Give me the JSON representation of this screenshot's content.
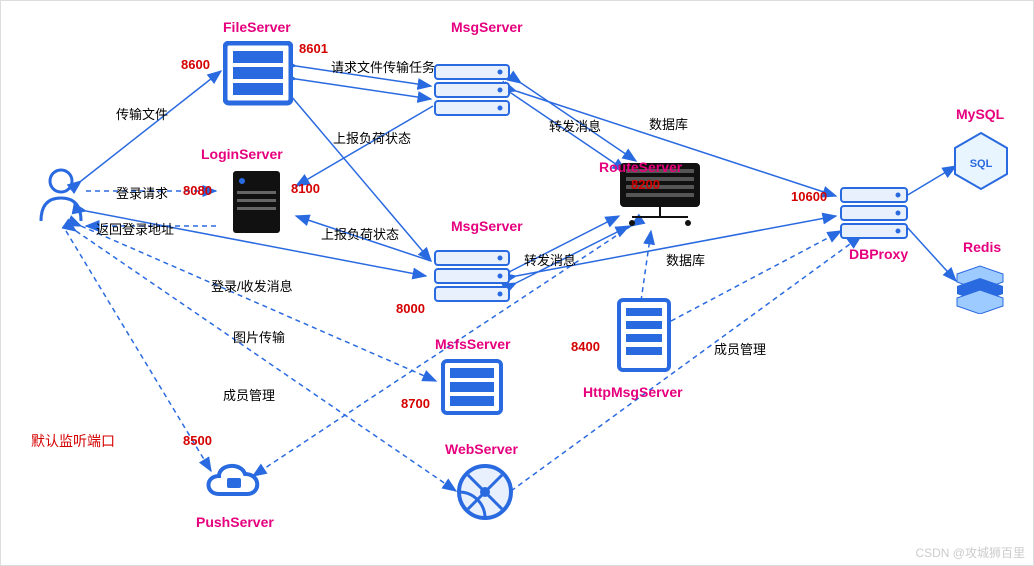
{
  "nodes": {
    "user": {
      "label": "",
      "port": null
    },
    "fileServer": {
      "label": "FileServer",
      "port": "8601",
      "port2": "8600"
    },
    "loginServer": {
      "label": "LoginServer",
      "port": "8100",
      "port2": "8080"
    },
    "msgServer1": {
      "label": "MsgServer",
      "port": null
    },
    "msgServer2": {
      "label": "MsgServer",
      "port": "8000"
    },
    "routeServer": {
      "label": "RouteServer",
      "port": "8200"
    },
    "dbProxy": {
      "label": "DBProxy",
      "port": "10600"
    },
    "mysql": {
      "label": "MySQL",
      "port": null
    },
    "redis": {
      "label": "Redis",
      "port": null
    },
    "msfsServer": {
      "label": "MsfsServer",
      "port": "8700"
    },
    "httpMsgServer": {
      "label": "HttpMsgServer",
      "port": "8400"
    },
    "webServer": {
      "label": "WebServer",
      "port": null
    },
    "pushServer": {
      "label": "PushServer",
      "port": "8500"
    }
  },
  "edges": {
    "e1": "传输文件",
    "e2": "登录请求",
    "e3": "返回登录地址",
    "e4": "登录/收发消息",
    "e5": "图片传输",
    "e6": "成员管理",
    "e7": "请求文件传输任务",
    "e8": "上报负荷状态",
    "e9": "上报负荷状态",
    "e10": "转发消息",
    "e11": "转发消息",
    "e12": "数据库",
    "e13": "数据库",
    "e14": "成员管理"
  },
  "note": "默认监听端口",
  "watermark": "CSDN @攻城狮百里"
}
